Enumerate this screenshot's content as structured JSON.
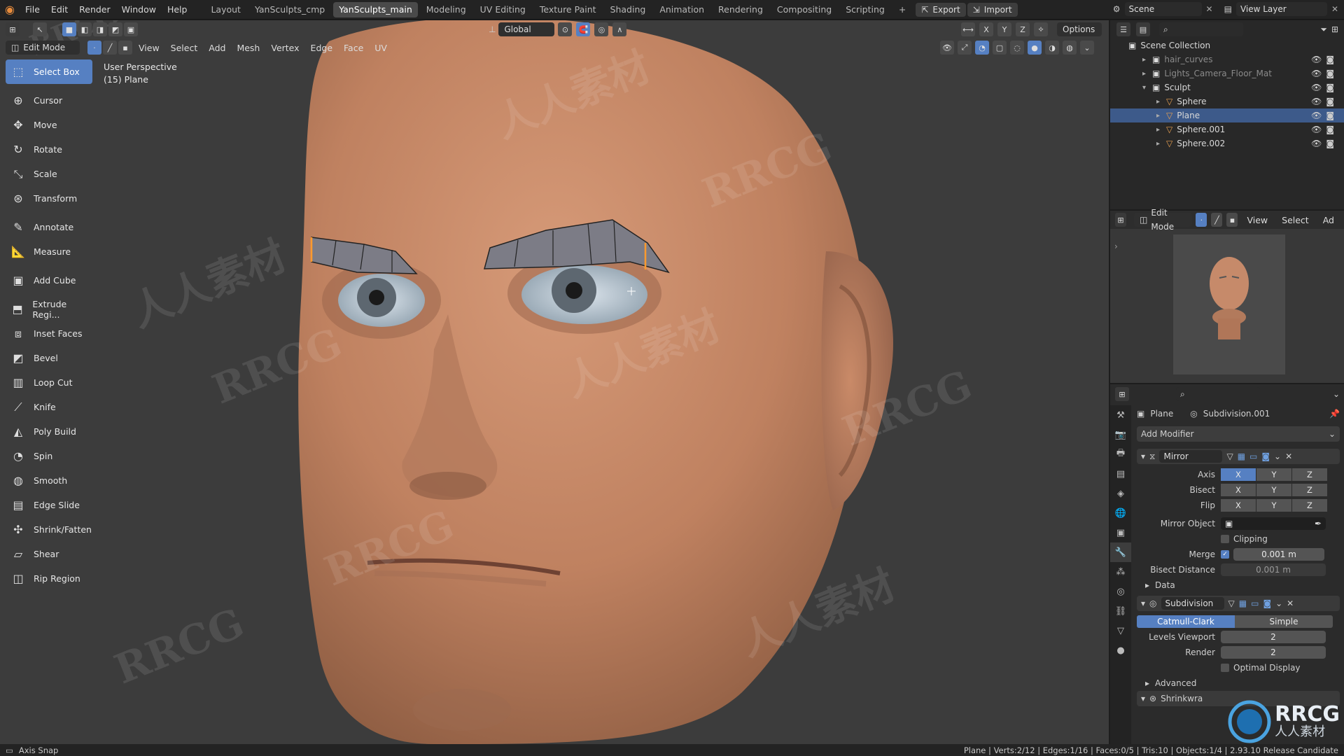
{
  "topbar": {
    "menus": [
      "File",
      "Edit",
      "Render",
      "Window",
      "Help"
    ],
    "workspaces": [
      "Layout",
      "YanSculpts_cmp",
      "YanSculpts_main",
      "Modeling",
      "UV Editing",
      "Texture Paint",
      "Shading",
      "Animation",
      "Rendering",
      "Compositing",
      "Scripting"
    ],
    "active_workspace": "YanSculpts_main",
    "add_workspace": "+",
    "export_label": "Export",
    "import_label": "Import",
    "scene_label": "Scene",
    "view_layer_label": "View Layer"
  },
  "viewport": {
    "mode": "Edit Mode",
    "menus": [
      "View",
      "Select",
      "Add",
      "Mesh",
      "Vertex",
      "Edge",
      "Face",
      "UV"
    ],
    "transform_orientation": "Global",
    "options_label": "Options",
    "axis_labels": [
      "X",
      "Y",
      "Z"
    ],
    "info_line1": "User Perspective",
    "info_line2": "(15) Plane"
  },
  "toolbar": {
    "tools": [
      {
        "label": "Select Box",
        "icon": "select-box-icon",
        "glyph": "⬚"
      },
      {
        "label": "Cursor",
        "icon": "cursor-icon",
        "glyph": "⊕"
      },
      {
        "label": "Move",
        "icon": "move-icon",
        "glyph": "✥"
      },
      {
        "label": "Rotate",
        "icon": "rotate-icon",
        "glyph": "↻"
      },
      {
        "label": "Scale",
        "icon": "scale-icon",
        "glyph": "⤡"
      },
      {
        "label": "Transform",
        "icon": "transform-icon",
        "glyph": "⊛"
      },
      {
        "label": "Annotate",
        "icon": "annotate-icon",
        "glyph": "✎"
      },
      {
        "label": "Measure",
        "icon": "measure-icon",
        "glyph": "📐"
      },
      {
        "label": "Add Cube",
        "icon": "add-cube-icon",
        "glyph": "▣"
      },
      {
        "label": "Extrude Regi...",
        "icon": "extrude-icon",
        "glyph": "⬒"
      },
      {
        "label": "Inset Faces",
        "icon": "inset-faces-icon",
        "glyph": "⧈"
      },
      {
        "label": "Bevel",
        "icon": "bevel-icon",
        "glyph": "◩"
      },
      {
        "label": "Loop Cut",
        "icon": "loop-cut-icon",
        "glyph": "▥"
      },
      {
        "label": "Knife",
        "icon": "knife-icon",
        "glyph": "⟋"
      },
      {
        "label": "Poly Build",
        "icon": "poly-build-icon",
        "glyph": "◭"
      },
      {
        "label": "Spin",
        "icon": "spin-icon",
        "glyph": "◔"
      },
      {
        "label": "Smooth",
        "icon": "smooth-icon",
        "glyph": "◍"
      },
      {
        "label": "Edge Slide",
        "icon": "edge-slide-icon",
        "glyph": "▤"
      },
      {
        "label": "Shrink/Fatten",
        "icon": "shrink-fatten-icon",
        "glyph": "✣"
      },
      {
        "label": "Shear",
        "icon": "shear-icon",
        "glyph": "▱"
      },
      {
        "label": "Rip Region",
        "icon": "rip-region-icon",
        "glyph": "◫"
      }
    ]
  },
  "outliner": {
    "root": "Scene Collection",
    "items": [
      {
        "label": "hair_curves",
        "level": 1,
        "dim": true
      },
      {
        "label": "Lights_Camera_Floor_Mat",
        "level": 1,
        "dim": true
      },
      {
        "label": "Sculpt",
        "level": 1,
        "dim": false
      },
      {
        "label": "Sphere",
        "level": 2,
        "dim": false
      },
      {
        "label": "Plane",
        "level": 2,
        "dim": false,
        "selected": true
      },
      {
        "label": "Sphere.001",
        "level": 2,
        "dim": false
      },
      {
        "label": "Sphere.002",
        "level": 2,
        "dim": false
      }
    ]
  },
  "preview": {
    "mode": "Edit Mode",
    "menus": [
      "View",
      "Select",
      "Ad"
    ]
  },
  "properties": {
    "object_name": "Plane",
    "active_modifier": "Subdivision.001",
    "add_modifier": "Add Modifier",
    "mirror": {
      "name": "Mirror",
      "axis_label": "Axis",
      "bisect_label": "Bisect",
      "flip_label": "Flip",
      "axes": [
        "X",
        "Y",
        "Z"
      ],
      "mirror_object_label": "Mirror Object",
      "clipping_label": "Clipping",
      "merge_label": "Merge",
      "merge_value": "0.001 m",
      "bisect_distance_label": "Bisect Distance",
      "bisect_distance_value": "0.001 m",
      "data_label": "Data"
    },
    "subdivision": {
      "name": "Subdivision",
      "catmull_label": "Catmull-Clark",
      "simple_label": "Simple",
      "levels_viewport_label": "Levels Viewport",
      "levels_viewport_value": "2",
      "render_label": "Render",
      "render_value": "2",
      "optimal_display_label": "Optimal Display",
      "advanced_label": "Advanced"
    },
    "shrinkwrap_label": "Shrinkwra"
  },
  "statusbar": {
    "left": "Axis Snap",
    "right": "Plane | Verts:2/12 | Edges:1/16 | Faces:0/5 | Tris:10 | Objects:1/4 | 2.93.10 Release Candidate"
  },
  "watermark": {
    "brand": "RRCG",
    "cn": "人人素材"
  },
  "colors": {
    "accent": "#5680c2",
    "skin": "#c88a6a",
    "viewport_bg": "#3c3c3c"
  }
}
